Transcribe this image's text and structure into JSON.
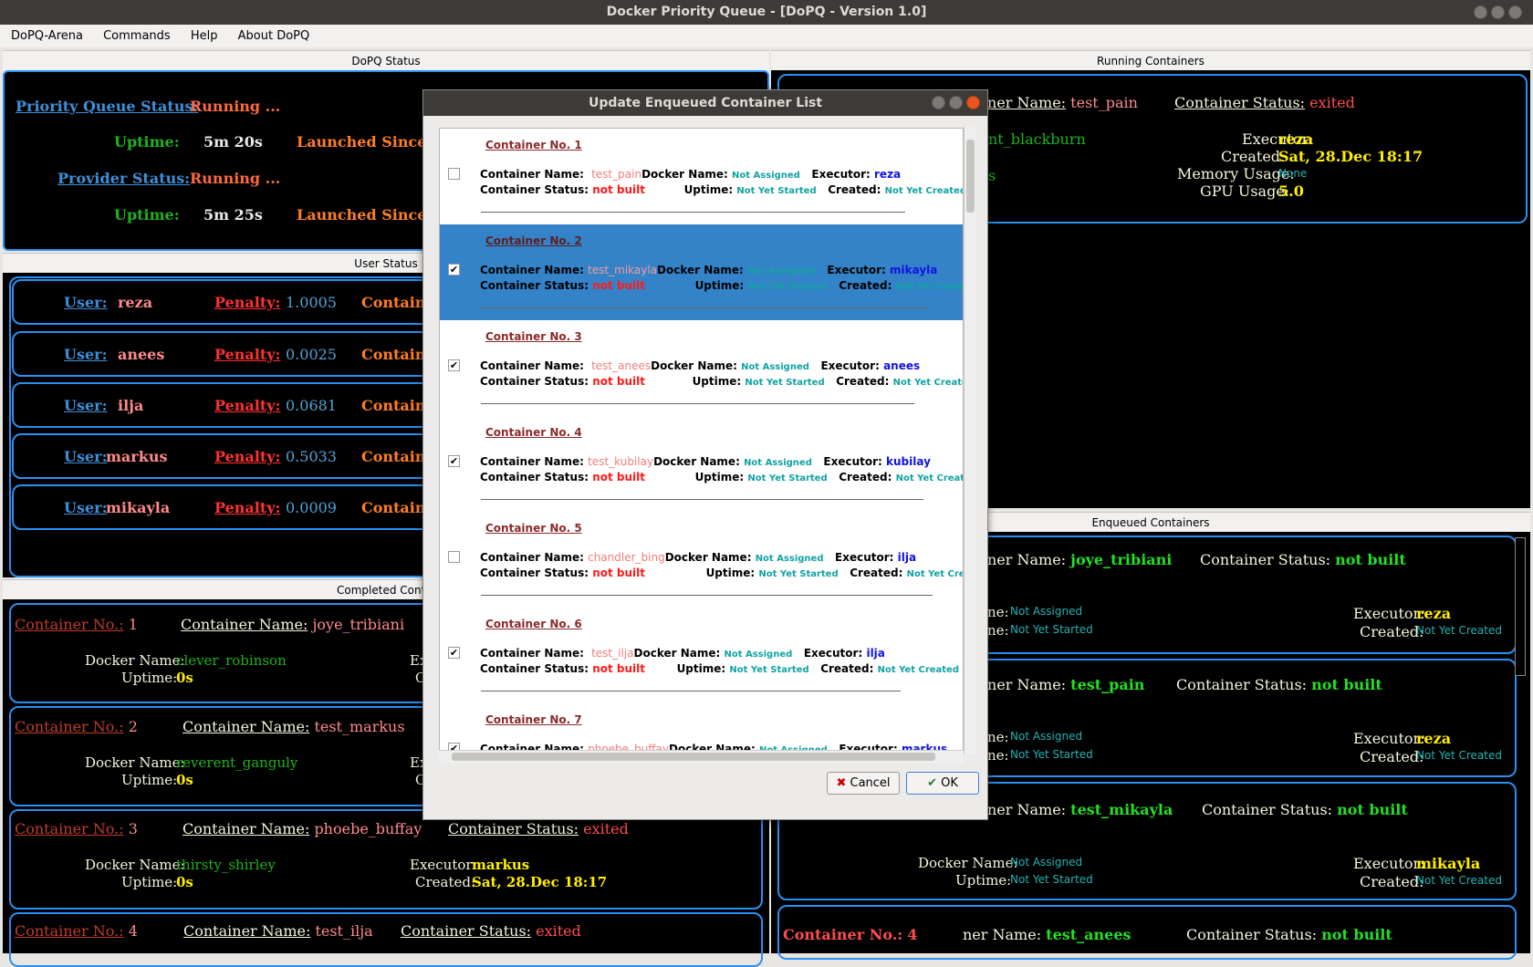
{
  "window": {
    "title": "Docker Priority Queue - [DoPQ - Version 1.0]"
  },
  "menu": [
    "DoPQ-Arena",
    "Commands",
    "Help",
    "About DoPQ"
  ],
  "status_panel": {
    "header": "DoPQ Status",
    "pq_label": "Priority Queue Status:",
    "pq_value": "Running ...",
    "uptime_label": "Uptime:",
    "pq_uptime": "5m 20s",
    "launched_label": "Launched Since:",
    "prov_label": "Provider Status:",
    "prov_value": "Running ...",
    "prov_uptime": "5m 25s"
  },
  "user_panel": {
    "header": "User Status",
    "user_label": "User:",
    "penalty_label": "Penalty:",
    "container_label": "Containe",
    "users": [
      {
        "name": "reza",
        "penalty": "1.0005"
      },
      {
        "name": "anees",
        "penalty": "0.0025"
      },
      {
        "name": "ilja",
        "penalty": "0.0681"
      },
      {
        "name": "markus",
        "penalty": "0.5033"
      },
      {
        "name": "mikayla",
        "penalty": "0.0009"
      }
    ]
  },
  "completed_panel": {
    "header": "Completed Contai",
    "no_label": "Container No.:",
    "name_label": "Container Name:",
    "docker_label": "Docker Name:",
    "uptime_label": "Uptime:",
    "status_label": "Container Status:",
    "executor_label": "Executor:",
    "created_label": "Created:",
    "items": [
      {
        "no": "1",
        "name": "joye_tribiani",
        "docker": "clever_robinson",
        "uptime": "0s"
      },
      {
        "no": "2",
        "name": "test_markus",
        "docker": "reverent_ganguly",
        "uptime": "0s"
      },
      {
        "no": "3",
        "name": "phoebe_buffay",
        "docker": "thirsty_shirley",
        "uptime": "0s",
        "status": "exited",
        "executor": "markus",
        "created": "Sat, 28.Dec 18:17"
      },
      {
        "no": "4",
        "name": "test_ilja",
        "status": "exited"
      }
    ],
    "trunc_ex": "Ex",
    "trunc_c": "C"
  },
  "running_panel": {
    "header": "Running Containers",
    "name_label_trunc": "ner Name:",
    "name": "test_pain",
    "status_label": "Container Status:",
    "status": "exited",
    "docker_trunc": "nt_blackburn",
    "executor_label": "Executor:",
    "executor": "reza",
    "created_label": "Created:",
    "created": "Sat, 28.Dec 18:17",
    "mem_label": "Memory Usage:",
    "mem": "None",
    "gpu_label": "GPU Usage:",
    "gpu": "5.0",
    "trunc_s": "s"
  },
  "enqueued_panel": {
    "header": "Enqueued Containers",
    "name_label_trunc": "ner Name:",
    "status_label": "Container Status:",
    "ne_trunc": "ne:",
    "executor_label": "Executor:",
    "created_label": "Created:",
    "docker_label": "Docker Name:",
    "uptime_label": "Uptime:",
    "not_assigned": "Not Assigned",
    "not_started": "Not Yet Started",
    "not_created": "Not Yet Created",
    "items": [
      {
        "name": "joye_tribiani",
        "status": "not built",
        "executor": "reza"
      },
      {
        "name": "test_pain",
        "status": "not built",
        "executor": "reza"
      },
      {
        "name": "test_mikayla",
        "status": "not built",
        "executor": "mikayla"
      }
    ],
    "last_no_label": "Container No.:",
    "last_no": "4",
    "last_name": "test_anees",
    "last_status": "not built"
  },
  "dialog": {
    "title": "Update Enqueued Container List",
    "labels": {
      "name": "Container Name:",
      "docker": "Docker Name:",
      "executor": "Executor:",
      "status": "Container Status:",
      "uptime": "Uptime:",
      "created": "Created:"
    },
    "not_assigned": "Not Assigned",
    "not_started": "Not Yet Started",
    "not_created": "Not Yet Created",
    "not_built": "not built",
    "entries": [
      {
        "no": "Container No. 1",
        "name": "test_pain",
        "executor": "reza",
        "checked": false
      },
      {
        "no": "Container No. 2",
        "name": "test_mikayla",
        "executor": "mikayla",
        "checked": true
      },
      {
        "no": "Container No. 3",
        "name": "test_anees",
        "executor": "anees",
        "checked": true
      },
      {
        "no": "Container No. 4",
        "name": "test_kubilay",
        "executor": "kubilay",
        "checked": true
      },
      {
        "no": "Container No. 5",
        "name": "chandler_bing",
        "executor": "ilja",
        "checked": false
      },
      {
        "no": "Container No. 6",
        "name": "test_ilja",
        "executor": "ilja",
        "checked": true
      },
      {
        "no": "Container No. 7",
        "name": "phoebe_buffay",
        "executor": "markus",
        "checked": true
      }
    ],
    "cancel": "Cancel",
    "ok": "OK"
  }
}
